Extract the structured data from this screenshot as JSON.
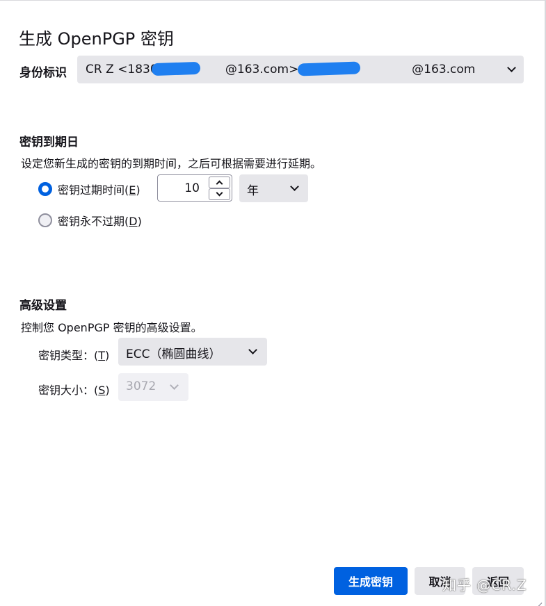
{
  "dialog": {
    "title": "生成 OpenPGP 密钥"
  },
  "identity": {
    "label": "身份标识",
    "value": "CR Z <1830                  @163.com> - 183                     @163.com"
  },
  "expiry": {
    "title": "密钥到期日",
    "description": "设定您新生成的密钥的到期时间，之后可根据需要进行延期。",
    "option_expire": {
      "label": "密钥过期时间(",
      "key": "E",
      "suffix": ")",
      "checked": true
    },
    "option_never": {
      "label": "密钥永不过期(",
      "key": "D",
      "suffix": ")",
      "checked": false
    },
    "amount": "10",
    "unit": "年"
  },
  "advanced": {
    "title": "高级设置",
    "description": "控制您 OpenPGP 密钥的高级设置。",
    "key_type": {
      "label": "密钥类型：(",
      "key": "T",
      "suffix": ")",
      "value": "ECC（椭圆曲线）"
    },
    "key_size": {
      "label": "密钥大小：(",
      "key": "S",
      "suffix": ")",
      "value": "3072"
    }
  },
  "buttons": {
    "generate": "生成密钥",
    "cancel": "取消",
    "back": "返回"
  },
  "watermark": "知乎 @CR.Z",
  "colors": {
    "accent": "#0061e0",
    "select_bg": "#e6e6ea",
    "redaction": "#1f7ff0"
  },
  "icons": [
    "chevron-down-icon",
    "spin-up-icon",
    "spin-down-icon",
    "resize-grip-icon"
  ]
}
